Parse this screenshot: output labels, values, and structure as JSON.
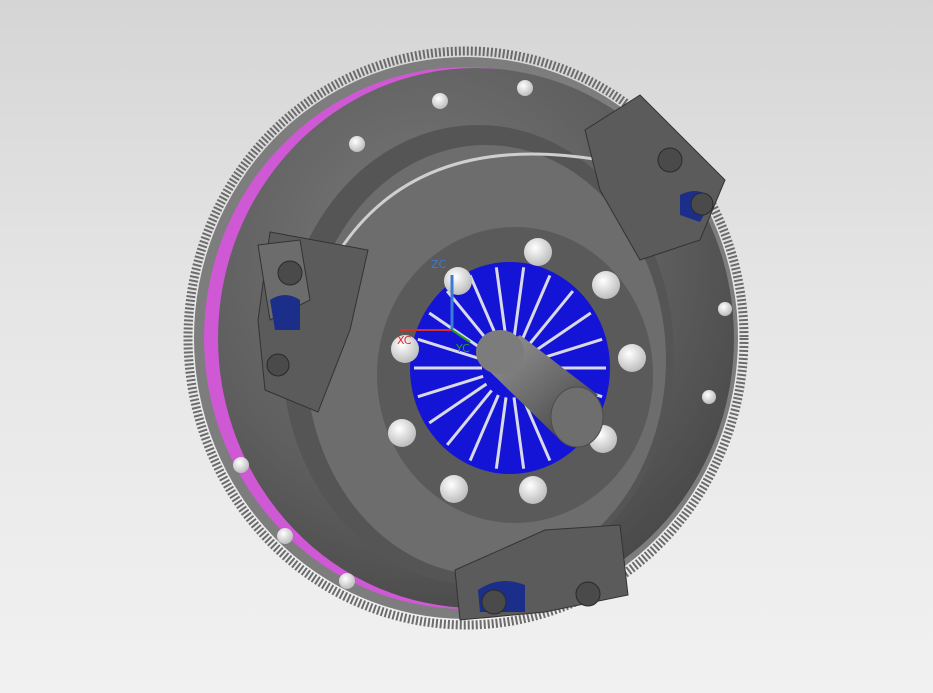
{
  "viewport": {
    "background_top": "#d5d5d5",
    "background_bottom": "#f1f1f1"
  },
  "model": {
    "parts": [
      "flywheel-ring-gear",
      "pressure-plate-cover",
      "diaphragm-spring",
      "input-shaft",
      "release-brackets"
    ],
    "colors": {
      "housing": "#5e5e5e",
      "housing_dark": "#3f3f3f",
      "housing_light": "#7a7a7a",
      "flywheel_face": "#cf58d4",
      "diaphragm": "#1414d6",
      "bolt": "#d9d9d9",
      "bracket_insert": "#1b2f8a"
    }
  },
  "triad": {
    "zc": "ZC",
    "xc": "XC",
    "yc": "YC",
    "zc_color": "#3a7bd5",
    "xc_color": "#d03030",
    "yc_color": "#2a9a2a"
  }
}
